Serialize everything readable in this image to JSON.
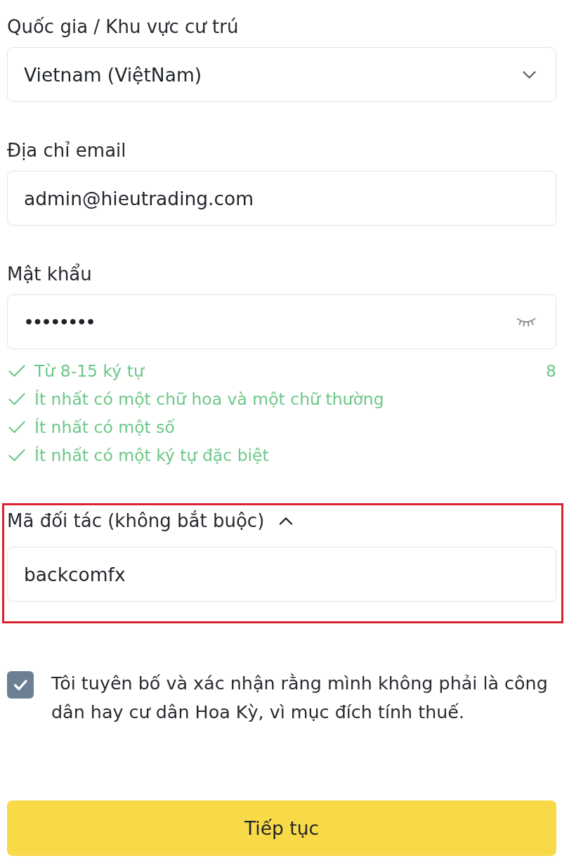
{
  "fields": [
    {
      "kind": "select",
      "label": "Quốc gia / Khu vực cư trú",
      "value": "Vietnam (ViệtNam)"
    },
    {
      "kind": "text",
      "label": "Địa chỉ email",
      "value": "admin@hieutrading.com"
    },
    {
      "kind": "password",
      "label": "Mật khẩu",
      "value": "••••••••"
    }
  ],
  "password_rules": [
    {
      "text": "Từ 8-15 ký tự",
      "met": true,
      "count": "8"
    },
    {
      "text": "Ít nhất có một chữ hoa và một chữ thường",
      "met": true
    },
    {
      "text": "Ít nhất có một số",
      "met": true
    },
    {
      "text": "Ít nhất có một ký tự đặc biệt",
      "met": true
    }
  ],
  "referral": {
    "label": "Mã đối tác (không bắt buộc)",
    "expanded": true,
    "highlighted": true,
    "value": "backcomfx"
  },
  "declaration": {
    "checked": true,
    "text": "Tôi tuyên bố và xác nhận rằng mình không phải là công dân hay cư dân Hoa Kỳ, vì mục đích tính thuế."
  },
  "submit_button": {
    "label": "Tiếp tục"
  }
}
